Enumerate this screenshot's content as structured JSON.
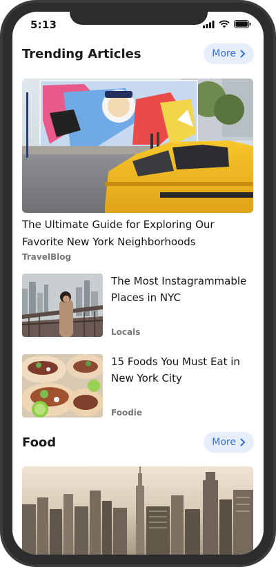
{
  "status_bar": {
    "time": "5:13"
  },
  "trending": {
    "title": "Trending Articles",
    "more_label": "More",
    "featured": {
      "title": "The Ultimate Guide for Exploring Our Favorite New York Neighborhoods",
      "source": "TravelBlog"
    },
    "items": [
      {
        "title": "The Most Instagrammable Places in NYC",
        "source": "Locals"
      },
      {
        "title": "15 Foods You Must Eat in New York City",
        "source": "Foodie"
      }
    ]
  },
  "food": {
    "title": "Food",
    "more_label": "More"
  },
  "colors": {
    "accent": "#2f6fe8",
    "pill_bg": "#e6eefb",
    "frame": "#2c2c2f"
  }
}
